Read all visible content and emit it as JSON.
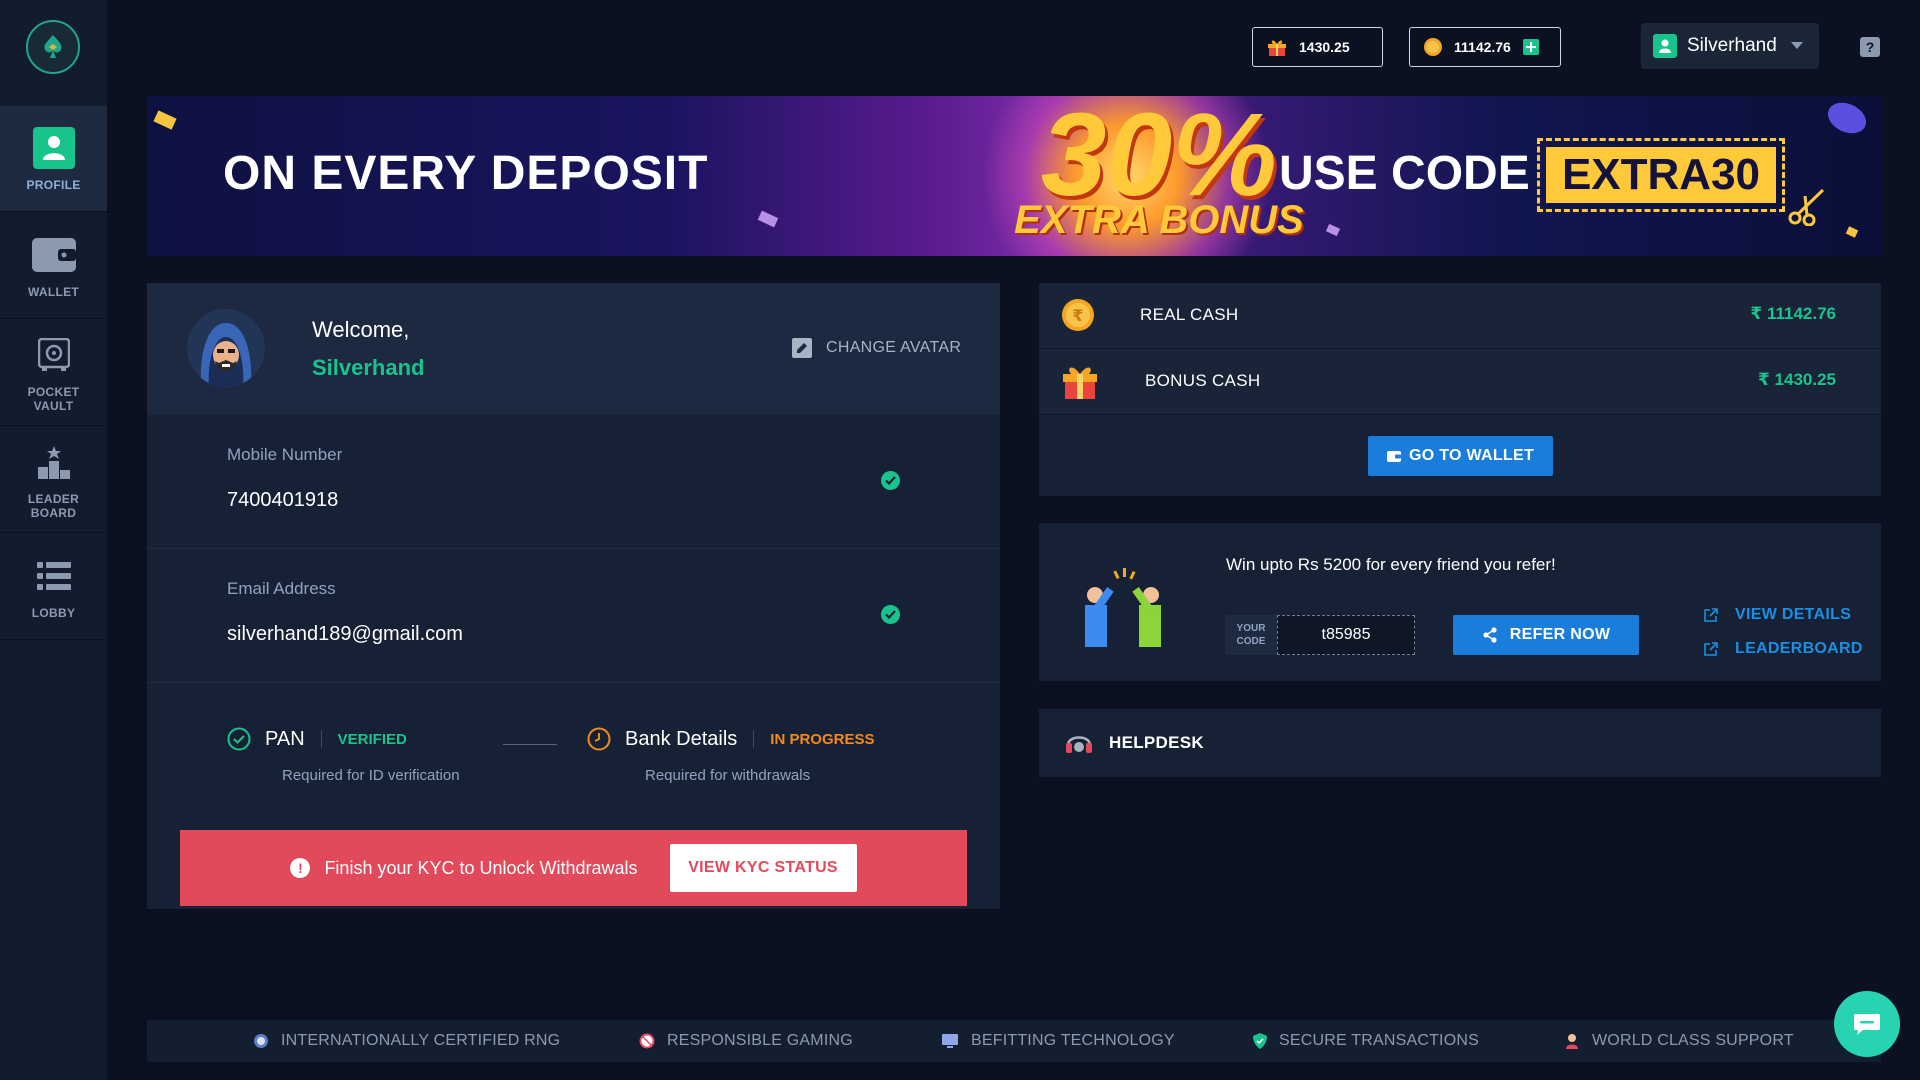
{
  "sidebar": {
    "items": [
      {
        "label": "PROFILE",
        "icon": "user-icon"
      },
      {
        "label": "WALLET",
        "icon": "wallet-icon"
      },
      {
        "label": "POCKET\nVAULT",
        "icon": "vault-icon"
      },
      {
        "label": "LEADER\nBOARD",
        "icon": "podium-icon"
      },
      {
        "label": "LOBBY",
        "icon": "list-icon"
      }
    ]
  },
  "topbar": {
    "bonus_balance": "1430.25",
    "cash_balance": "11142.76",
    "username": "Silverhand",
    "help": "?"
  },
  "banner": {
    "left_text": "ON EVERY DEPOSIT",
    "big_text": "30%",
    "sub_text": "EXTRA BONUS",
    "right_text": "USE CODE",
    "code": "EXTRA30"
  },
  "profile": {
    "welcome": "Welcome,",
    "name": "Silverhand",
    "change_avatar": "CHANGE AVATAR",
    "mobile_label": "Mobile Number",
    "mobile_value": "7400401918",
    "email_label": "Email Address",
    "email_value": "silverhand189@gmail.com",
    "kyc": {
      "pan_title": "PAN",
      "pan_status": "VERIFIED",
      "pan_sub": "Required for ID verification",
      "bank_title": "Bank Details",
      "bank_status": "IN PROGRESS",
      "bank_sub": "Required for withdrawals"
    },
    "alert_text": "Finish your KYC to Unlock Withdrawals",
    "alert_button": "VIEW KYC STATUS"
  },
  "wallet": {
    "real_label": "REAL CASH",
    "real_amount": "₹ 11142.76",
    "bonus_label": "BONUS CASH",
    "bonus_amount": "₹ 1430.25",
    "go_button": "GO TO WALLET"
  },
  "refer": {
    "title": "Win upto Rs 5200 for every friend you refer!",
    "code_tag_1": "YOUR",
    "code_tag_2": "CODE",
    "code": "t85985",
    "refer_button": "REFER NOW",
    "view_details": "VIEW DETAILS",
    "leaderboard": "LEADERBOARD"
  },
  "helpdesk": {
    "label": "HELPDESK"
  },
  "footer": {
    "items": [
      "INTERNATIONALLY CERTIFIED RNG",
      "RESPONSIBLE GAMING",
      "BEFITTING TECHNOLOGY",
      "SECURE TRANSACTIONS",
      "WORLD CLASS SUPPORT"
    ]
  },
  "colors": {
    "accent_green": "#19c48c",
    "accent_blue": "#1a7ddb",
    "alert_red": "#e24a5c",
    "status_orange": "#f08a1c",
    "bg": "#0b1120",
    "card": "#172135"
  }
}
